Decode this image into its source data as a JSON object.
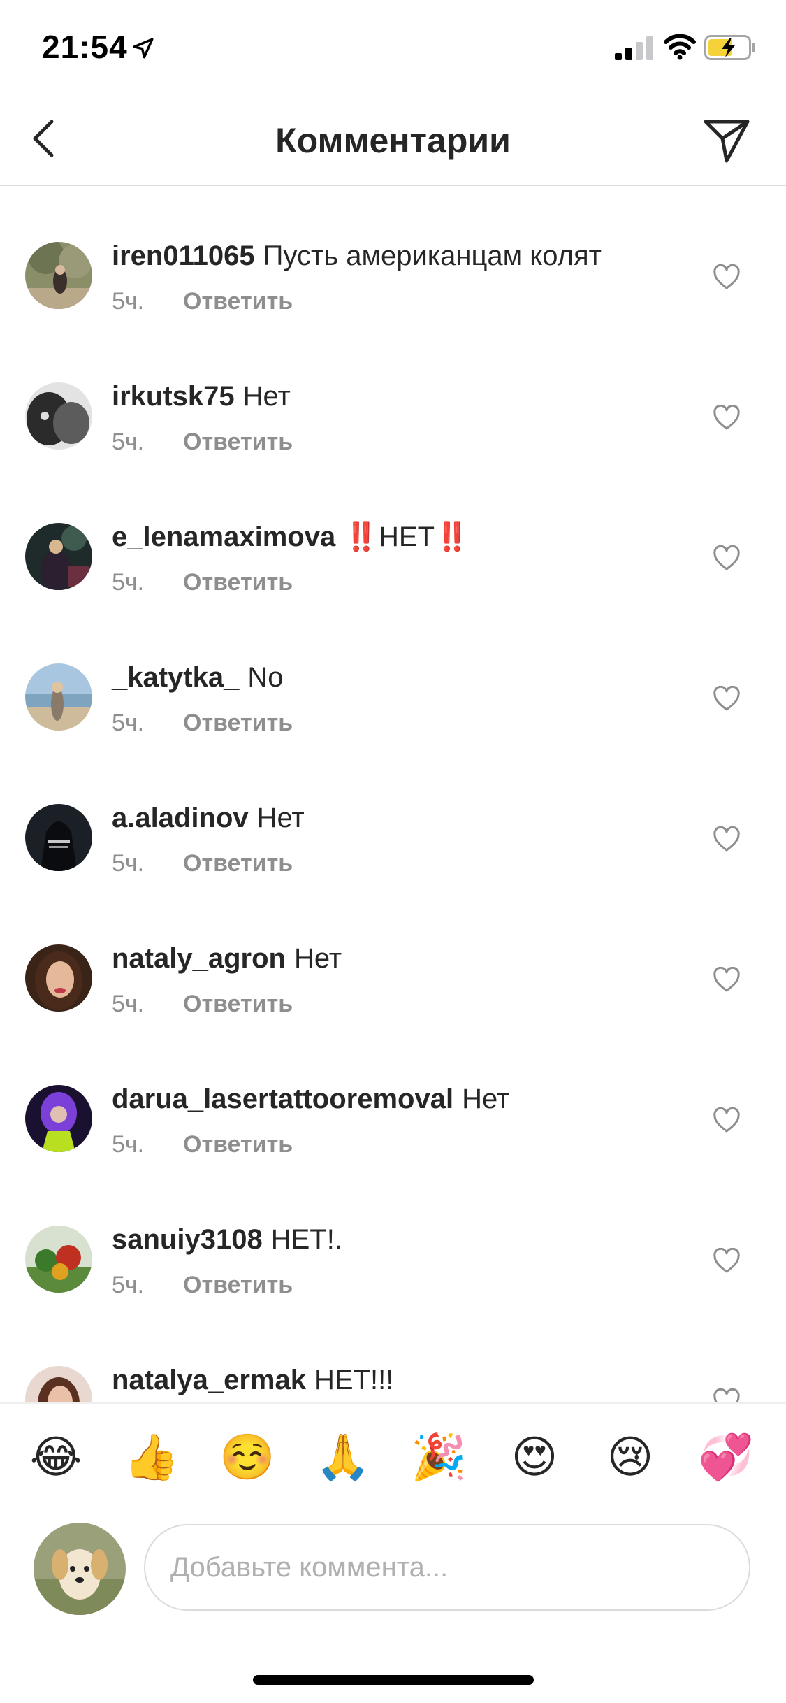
{
  "status_bar": {
    "time": "21:54",
    "icons": [
      "location-arrow-icon",
      "cellular-signal-icon",
      "wifi-icon",
      "battery-charging-icon"
    ],
    "battery_color": "#f5d23a"
  },
  "header": {
    "title": "Комментарии",
    "back_icon": "chevron-left-icon",
    "share_icon": "direct-message-icon"
  },
  "comments": [
    {
      "username": "iren011065",
      "text": "Пусть американцам колят",
      "time": "5ч.",
      "reply": "Ответить"
    },
    {
      "username": "irkutsk75",
      "text": "Нет",
      "time": "5ч.",
      "reply": "Ответить"
    },
    {
      "username": "e_lenamaximova",
      "text": "‼️НЕТ‼️",
      "time": "5ч.",
      "reply": "Ответить"
    },
    {
      "username": "_katytka_",
      "text": "No",
      "time": "5ч.",
      "reply": "Ответить"
    },
    {
      "username": "a.aladinov",
      "text": "Нет",
      "time": "5ч.",
      "reply": "Ответить"
    },
    {
      "username": "nataly_agron",
      "text": "Нет",
      "time": "5ч.",
      "reply": "Ответить"
    },
    {
      "username": "darua_lasertattooremoval",
      "text": "Нет",
      "time": "5ч.",
      "reply": "Ответить"
    },
    {
      "username": "sanuiy3108",
      "text": "НЕТ!.",
      "time": "5ч.",
      "reply": "Ответить"
    },
    {
      "username": "natalya_ermak",
      "text": "НЕТ!!!",
      "time": "",
      "reply": ""
    }
  ],
  "emoji_bar": [
    "😂",
    "👍",
    "☺️",
    "🙏",
    "🎉",
    "😍",
    "😢",
    "💞"
  ],
  "composer": {
    "placeholder": "Добавьте коммента..."
  },
  "colors": {
    "text_primary": "#262626",
    "text_secondary": "#8e8e8e",
    "divider": "#dbdbdb"
  }
}
